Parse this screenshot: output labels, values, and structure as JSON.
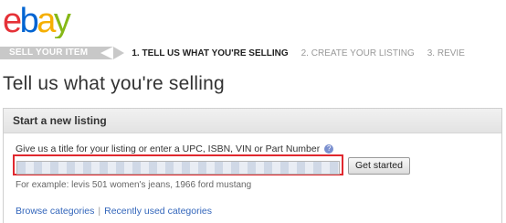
{
  "brand": {
    "logo_text": "ebay",
    "logo_colors": [
      "#e53238",
      "#0064d2",
      "#f5af02",
      "#86b817"
    ]
  },
  "steps": [
    {
      "label": "SELL YOUR ITEM",
      "state": "section"
    },
    {
      "label": "1. TELL US WHAT YOU'RE SELLING",
      "state": "active"
    },
    {
      "label": "2. CREATE YOUR LISTING",
      "state": "upcoming"
    },
    {
      "label": "3. REVIE",
      "state": "upcoming"
    }
  ],
  "page": {
    "title": "Tell us what you're selling"
  },
  "listing": {
    "header": "Start a new listing",
    "prompt": "Give us a title for your listing or enter a UPC, ISBN, VIN or Part Number",
    "help_icon": "?",
    "input_value": "",
    "button_label": "Get started",
    "example": "For example: levis 501 women's jeans, 1966 ford mustang",
    "highlight_color": "#e0282e"
  },
  "links": {
    "browse": "Browse categories",
    "separator": "|",
    "recent": "Recently used categories"
  }
}
